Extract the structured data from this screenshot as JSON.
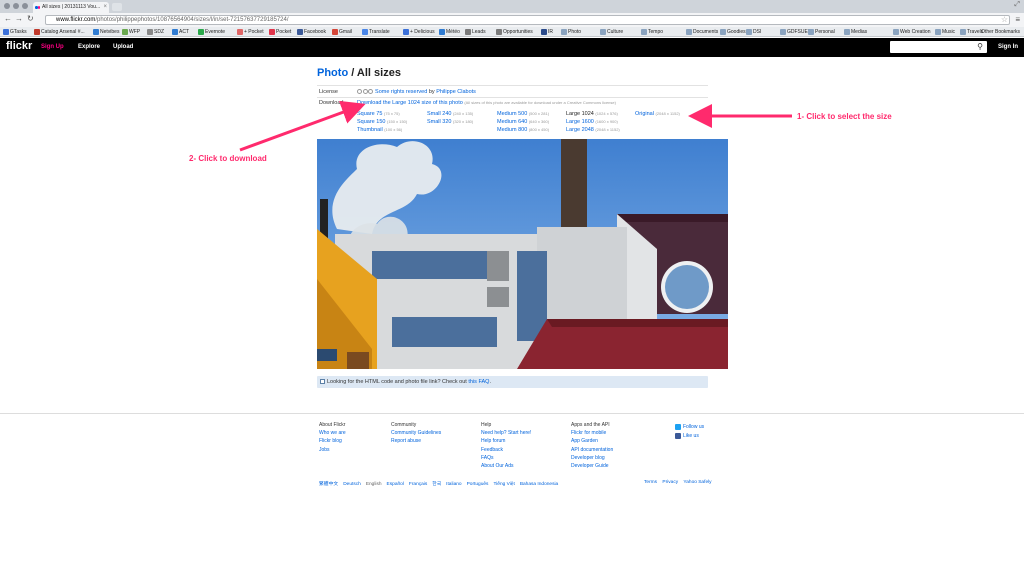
{
  "browser": {
    "tab_title": "All sizes | 20131113 Vou...",
    "tab_close": "×",
    "url_host": "www.flickr.com",
    "url_path": "/photos/philippephotos/10876564904/sizes/l/in/set-72157637729185724/",
    "bookmarks": [
      "GTasks",
      "Catalog Arsenal #...",
      "Netvibes",
      "WFP",
      "SDZ",
      "ACT",
      "Evernote",
      "+ Pocket",
      "Pocket",
      "Facebook",
      "Gmail",
      "Translate",
      "+ Delicious",
      "Météo",
      "Leads",
      "Opportunities",
      "IR",
      "Photo",
      "Culture",
      "Tempo",
      "Documents",
      "Goodies",
      "DSI",
      "GDFSUEZ",
      "Personal",
      "Medias",
      "Web Creation",
      "Music",
      "Travels"
    ],
    "other_bookmarks": "Other Bookmarks",
    "colors": {
      "bookmark_icons": [
        "#3a6fd8",
        "#c0392b",
        "#2f7bd1",
        "#6aa84f",
        "#888",
        "#2f7bd1",
        "#2aa84a",
        "#e06666",
        "#e0344a",
        "#3b5998",
        "#d44638",
        "#4a86e8",
        "#3a6fd8",
        "#2f7bd1",
        "#7a7a7a",
        "#7a7a7a",
        "#2a4a8a",
        "#8aa3bf",
        "#8aa3bf",
        "#8aa3bf",
        "#8aa3bf",
        "#8aa3bf",
        "#8aa3bf",
        "#8aa3bf",
        "#8aa3bf",
        "#8aa3bf",
        "#8aa3bf",
        "#8aa3bf",
        "#8aa3bf"
      ]
    }
  },
  "flickr_nav": {
    "logo": "flickr",
    "signup": "Sign Up",
    "explore": "Explore",
    "upload": "Upload",
    "signin": "Sign In",
    "search_placeholder": ""
  },
  "page": {
    "title_link": "Photo",
    "title_rest": " / All sizes",
    "license_label": "License",
    "license_text": "Some rights reserved",
    "license_by": " by ",
    "license_author": "Philippe Clabots",
    "download_label": "Download",
    "download_link": "Download the Large 1024 size of this photo",
    "download_note": "(All sizes of this photo are available for download under a Creative Commons license)",
    "sizes": [
      {
        "name": "Square 75",
        "dim": "(75 x 75)"
      },
      {
        "name": "Square 150",
        "dim": "(150 x 150)"
      },
      {
        "name": "Thumbnail",
        "dim": "(100 x 56)"
      },
      {
        "name": "Small 240",
        "dim": "(240 x 135)"
      },
      {
        "name": "Small 320",
        "dim": "(320 x 180)"
      },
      {
        "name": "Medium 500",
        "dim": "(500 x 281)"
      },
      {
        "name": "Medium 640",
        "dim": "(640 x 360)"
      },
      {
        "name": "Medium 800",
        "dim": "(800 x 450)"
      },
      {
        "name": "Large 1024",
        "dim": "(1024 x 576)"
      },
      {
        "name": "Large 1600",
        "dim": "(1600 x 900)"
      },
      {
        "name": "Large 2048",
        "dim": "(2048 x 1152)"
      },
      {
        "name": "Original",
        "dim": "(2048 x 1152)"
      }
    ],
    "faq_text": "Looking for the HTML code and photo file link? Check out ",
    "faq_link": "this FAQ",
    "faq_end": "."
  },
  "annotations": {
    "select": "1- Click to select the size",
    "download": "2- Click to download",
    "color": "#ff2a6d"
  },
  "footer": {
    "about": {
      "heading": "About Flickr",
      "items": [
        "Who we are",
        "Flickr blog",
        "Jobs"
      ]
    },
    "community": {
      "heading": "Community",
      "items": [
        "Community Guidelines",
        "Report abuse"
      ]
    },
    "help": {
      "heading": "Help",
      "items": [
        "Need help? Start here!",
        "Help forum",
        "Feedback",
        "FAQs",
        "About Our Ads"
      ]
    },
    "api": {
      "heading": "Apps and the API",
      "items": [
        "Flickr for mobile",
        "App Garden",
        "API documentation",
        "Developer blog",
        "Developer Guide"
      ]
    },
    "follow_us": "Follow us",
    "like_us": "Like us",
    "languages": [
      "繁體中文",
      "Deutsch",
      "English",
      "Español",
      "Français",
      "한국",
      "Italiano",
      "Português",
      "Tiếng Việt",
      "Bahasa Indonesia"
    ],
    "legal": [
      "Terms",
      "Privacy",
      "Yahoo Safely"
    ]
  }
}
